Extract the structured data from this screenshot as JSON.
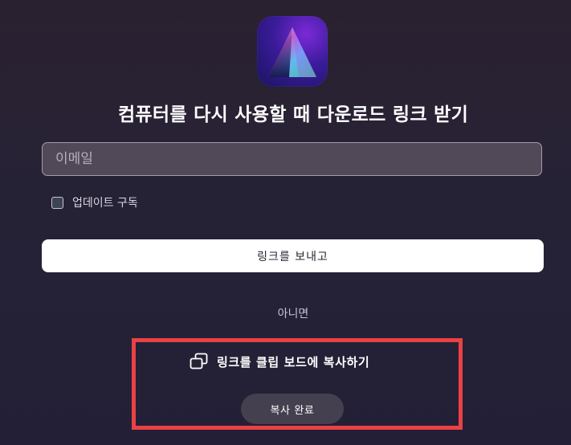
{
  "app_icon": {
    "name": "triangle-prism-icon"
  },
  "headline": "컴퓨터를 다시 사용할 때 다운로드 링크 받기",
  "email": {
    "placeholder": "이메일",
    "value": ""
  },
  "subscribe": {
    "label": "업데이트 구독",
    "checked": false
  },
  "send_button": {
    "label": "링크를 보내고"
  },
  "or_text": "아니면",
  "copy_link": {
    "icon": "copy-icon",
    "label": "링크를 클립 보드에 복사하기"
  },
  "copied_status": "복사 완료",
  "colors": {
    "background": "#262236",
    "input_bg": "#514858",
    "button_bg": "#ffffff",
    "highlight_border": "#ea4145",
    "badge_bg": "#45404f"
  }
}
